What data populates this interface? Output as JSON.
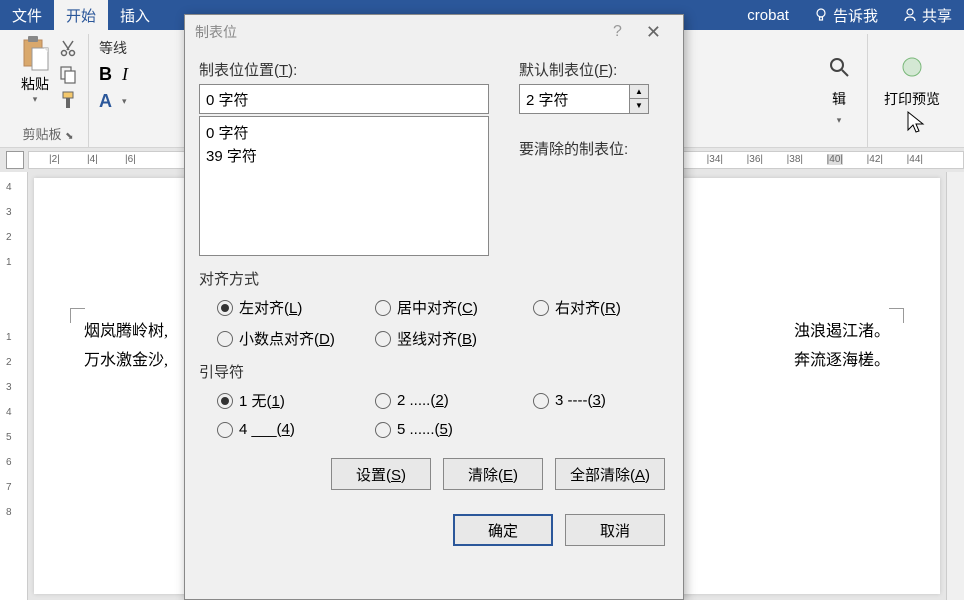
{
  "menu": {
    "file": "文件",
    "home": "开始",
    "insert": "插入",
    "acrobat": "crobat",
    "tellme": "告诉我",
    "share": "共享"
  },
  "ribbon": {
    "paste": "粘贴",
    "clipboard_label": "剪贴板",
    "font_name": "等线",
    "edit": "辑",
    "preview": "打印预览"
  },
  "ruler": {
    "left_marks": [
      "2",
      "4",
      "6"
    ],
    "right_marks": [
      "34",
      "36",
      "38",
      "40",
      "42",
      "44"
    ]
  },
  "vruler": {
    "top_marks": [
      "4",
      "3",
      "2",
      "1"
    ],
    "bottom_marks": [
      "1",
      "2",
      "3",
      "4",
      "5",
      "6",
      "7",
      "8"
    ]
  },
  "document": {
    "line1_left": "烟岚腾岭树,",
    "line1_right": "浊浪遏江渚。",
    "line2_left": "万水激金沙,",
    "line2_right": "奔流逐海槎。"
  },
  "dialog": {
    "title": "制表位",
    "pos_label": "制表位位置(T):",
    "pos_value": "0 字符",
    "list": [
      "0 字符",
      "39 字符"
    ],
    "default_label": "默认制表位(F):",
    "default_value": "2 字符",
    "clear_label": "要清除的制表位:",
    "align_title": "对齐方式",
    "align": {
      "left": "左对齐(L)",
      "center": "居中对齐(C)",
      "right": "右对齐(R)",
      "decimal": "小数点对齐(D)",
      "bar": "竖线对齐(B)"
    },
    "leader_title": "引导符",
    "leader": {
      "l1": "1 无(1)",
      "l2": "2 .....(2)",
      "l3": "3 ----(3)",
      "l4": "4 ___(4)",
      "l5": "5 ......(5)"
    },
    "btn_set": "设置(S)",
    "btn_clear": "清除(E)",
    "btn_clear_all": "全部清除(A)",
    "btn_ok": "确定",
    "btn_cancel": "取消"
  }
}
